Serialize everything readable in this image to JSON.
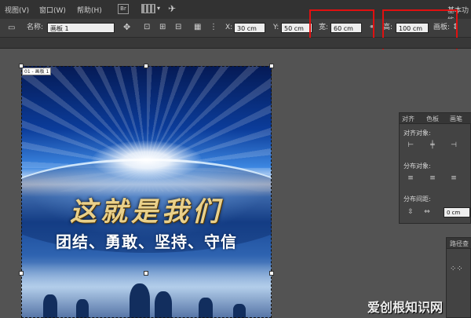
{
  "menu": {
    "view": "视图(V)",
    "window": "窗口(W)",
    "help": "帮助(H)",
    "br_badge": "Br",
    "workspace": "基本功能"
  },
  "control": {
    "name_label": "名称:",
    "name_value": "画板 1",
    "x_label": "X:",
    "x_value": "30 cm",
    "y_label": "Y:",
    "y_value": "50 cm",
    "width_label": "宽:",
    "width_value": "60 cm",
    "height_label": "高:",
    "height_value": "100 cm",
    "artboard_label": "画板:"
  },
  "artboard": {
    "tag": "01 - 画板 1",
    "title": "这就是我们",
    "subtitle": "团结、勇敢、坚持、守信"
  },
  "align_panel": {
    "tabs": [
      "对齐",
      "色板",
      "画笔"
    ],
    "align_objects": "对齐对象:",
    "distribute_objects": "分布对象:",
    "distribute_spacing": "分布间距:",
    "spacing_value": "0 cm"
  },
  "path_panel": {
    "title": "路径查"
  },
  "watermark": "爱创根知识网",
  "colors": {
    "highlight": "#e01010",
    "panel_bg": "#434343",
    "menubar_bg": "#323232"
  }
}
